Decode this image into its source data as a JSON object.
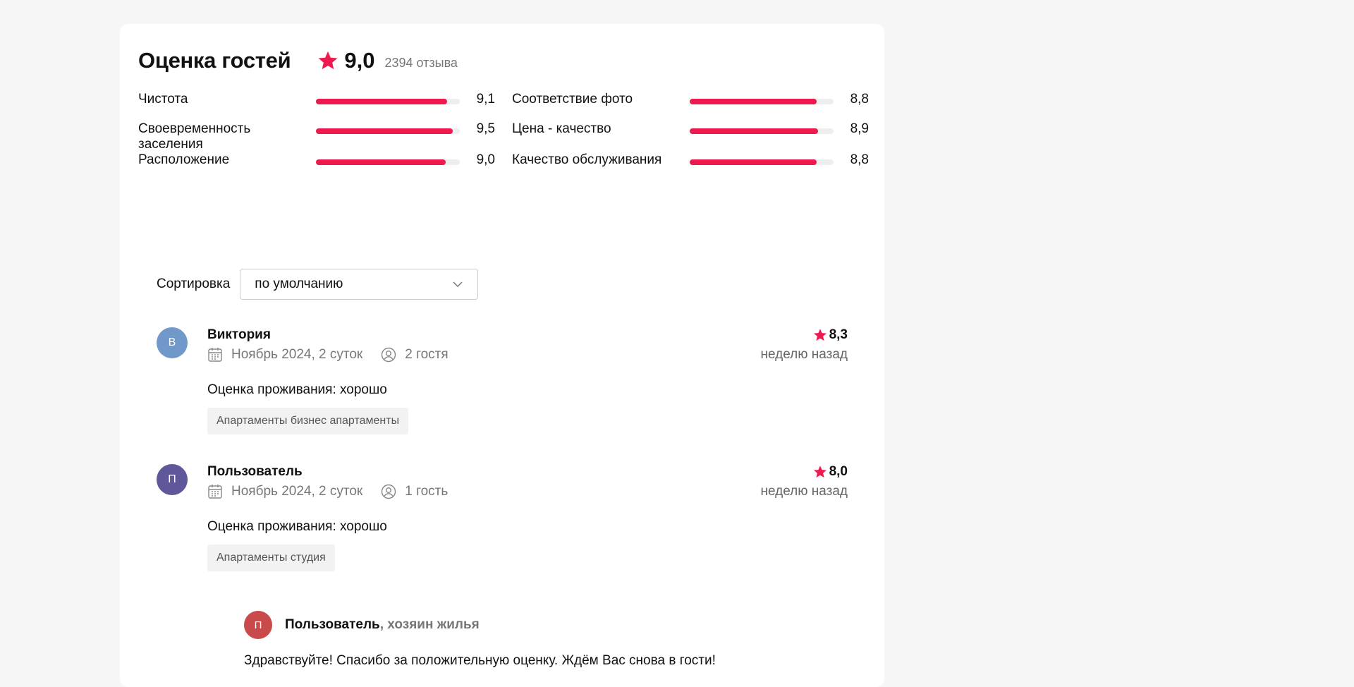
{
  "summary": {
    "title": "Оценка гостей",
    "score": "9,0",
    "review_count": "2394 отзыва",
    "accent_color": "#ee1a4f",
    "metrics": [
      {
        "label": "Чистота",
        "value": "9,1",
        "fill_percent": 91
      },
      {
        "label": "Соответствие фото",
        "value": "8,8",
        "fill_percent": 88
      },
      {
        "label": "Своевременность заселения",
        "value": "9,5",
        "fill_percent": 95
      },
      {
        "label": "Цена - качество",
        "value": "8,9",
        "fill_percent": 89
      },
      {
        "label": "Расположение",
        "value": "9,0",
        "fill_percent": 90
      },
      {
        "label": "Качество обслуживания",
        "value": "8,8",
        "fill_percent": 88
      }
    ]
  },
  "sort": {
    "label": "Сортировка",
    "selected": "по умолчанию"
  },
  "reviews": [
    {
      "initial": "В",
      "avatar_color": "#7098c8",
      "author": "Виктория",
      "stay": "Ноябрь 2024, 2 суток",
      "guests": "2 гостя",
      "rating": "8,3",
      "ago": "неделю назад",
      "verdict": "Оценка проживания: хорошо",
      "tag": "Апартаменты бизнес апартаменты"
    },
    {
      "initial": "П",
      "avatar_color": "#5e589a",
      "author": "Пользователь",
      "stay": "Ноябрь 2024, 2 суток",
      "guests": "1 гость",
      "rating": "8,0",
      "ago": "неделю назад",
      "verdict": "Оценка проживания: хорошо",
      "tag": "Апартаменты студия",
      "reply": {
        "initial": "П",
        "author": "Пользователь",
        "role": ", хозяин жилья",
        "text": "Здравствуйте! Спасибо за положительную оценку. Ждём Вас снова в гости!"
      }
    }
  ]
}
